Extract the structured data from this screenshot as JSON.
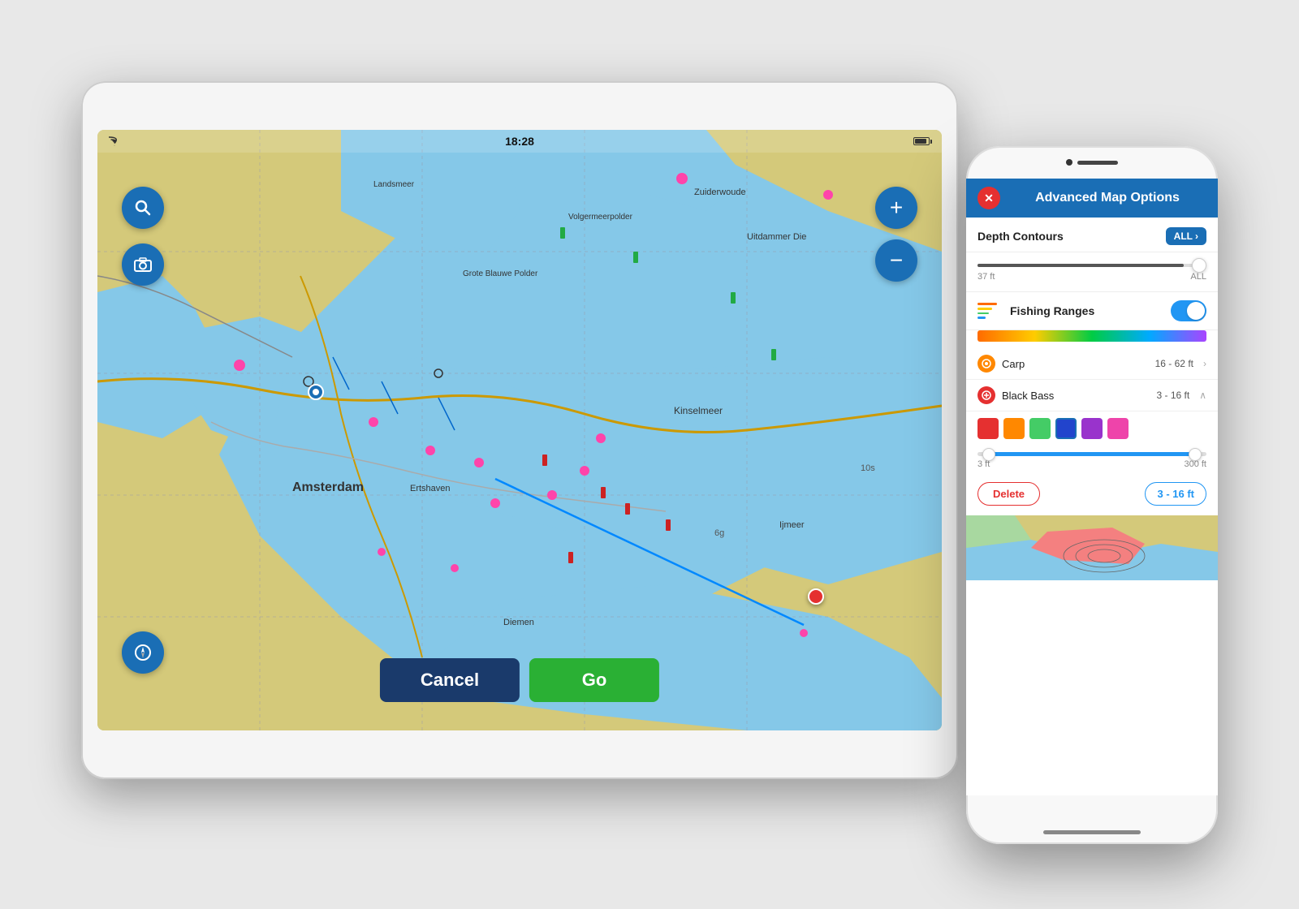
{
  "scene": {
    "background": "#e0e0e0"
  },
  "tablet": {
    "status_bar": {
      "wifi": "wifi",
      "time": "18:28",
      "battery": "battery"
    },
    "map": {
      "place_labels": [
        "Amsterdam",
        "Kinselmeer",
        "Zuiderwoude",
        "Uitdammer Die",
        "Ertshaven",
        "Diemen",
        "Ijmeer",
        "Volgermeerpolder",
        "Grote Blauwe Polder",
        "Landsmeer"
      ],
      "depth_label": "10s",
      "depth_label2": "6g"
    },
    "buttons": {
      "search": "🔍",
      "camera": "📷",
      "zoom_in": "+",
      "zoom_out": "−",
      "compass": "↑",
      "cancel": "Cancel",
      "go": "Go"
    }
  },
  "phone": {
    "panel": {
      "title": "Advanced Map Options",
      "close": "✕",
      "depth_contours": {
        "label": "Depth Contours",
        "badge": "ALL",
        "badge_arrow": "›",
        "slider_min": "37 ft",
        "slider_max": "ALL"
      },
      "fishing_ranges": {
        "label": "Fishing Ranges",
        "toggle": true
      },
      "species": [
        {
          "name": "Carp",
          "range": "16 - 62 ft",
          "icon_color": "#ff8800"
        },
        {
          "name": "Black Bass",
          "range": "3 - 16 ft",
          "icon_color": "#e53030"
        }
      ],
      "swatches": [
        "#e53030",
        "#ff8800",
        "#44cc66",
        "#2244cc",
        "#9933cc",
        "#ee44aa"
      ],
      "range_slider": {
        "min": "3 ft",
        "max": "300 ft"
      },
      "delete_label": "Delete",
      "range_label": "3 - 16 ft"
    }
  }
}
